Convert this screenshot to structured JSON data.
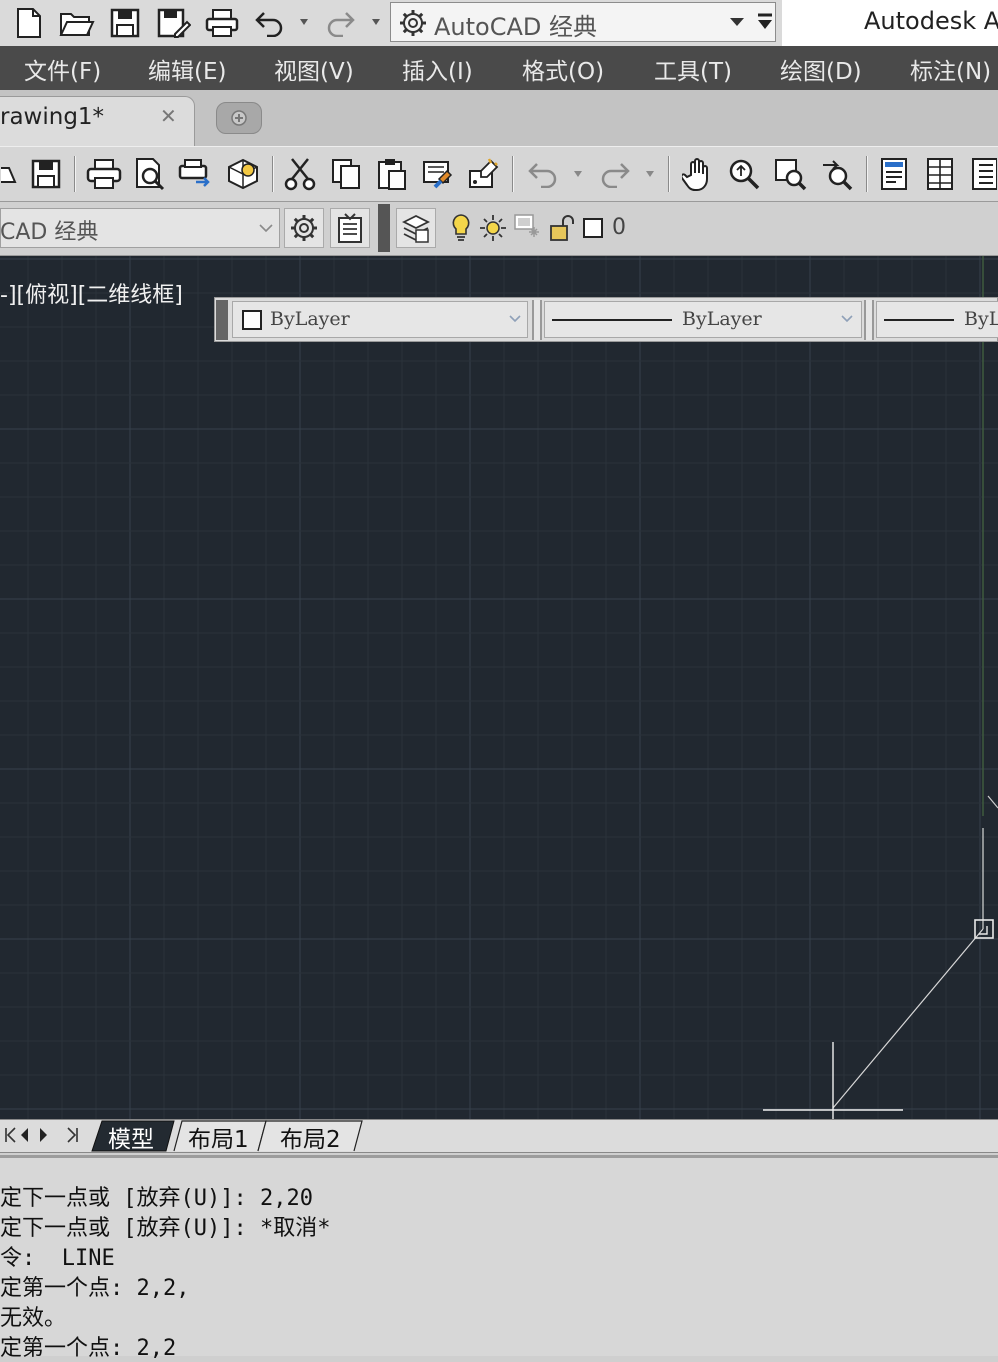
{
  "quick_access": {
    "workspace_value": "AutoCAD 经典",
    "app_title": "Autodesk A",
    "icons": [
      "new-file-icon",
      "open-folder-icon",
      "save-icon",
      "save-as-icon",
      "plot-icon",
      "undo-icon",
      "redo-icon",
      "gear-icon"
    ]
  },
  "menu": {
    "items": [
      "文件(F)",
      "编辑(E)",
      "视图(V)",
      "插入(I)",
      "格式(O)",
      "工具(T)",
      "绘图(D)",
      "标注(N)"
    ]
  },
  "tabs": {
    "document": "rawing1*",
    "close_glyph": "✕"
  },
  "workspace_toolbar": {
    "workspace_value": "CAD 经典",
    "layer_name": "0"
  },
  "viewport": {
    "label": "-][俯视][二维线框]"
  },
  "properties": {
    "color": "ByLayer",
    "linetype": "ByLayer",
    "lineweight": "ByL"
  },
  "layout_tabs": {
    "items": [
      "模型",
      "布局1",
      "布局2"
    ]
  },
  "command_lines": [
    "定下一点或 [放弃(U)]: 2,20",
    "定下一点或 [放弃(U)]: *取消*",
    "令:  LINE",
    "定第一个点: 2,2,",
    "无效。",
    "定第一个点: 2,2"
  ],
  "colors": {
    "canvas_bg": "#212830",
    "menu_bg": "#4a4a4a",
    "grid_minor": "#2a323a",
    "grid_major": "#36414b"
  }
}
